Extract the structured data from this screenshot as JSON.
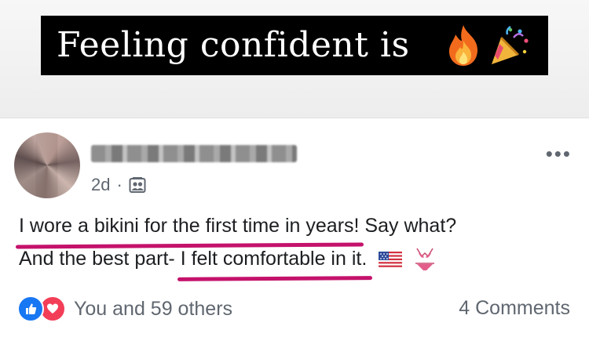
{
  "caption": {
    "text": "Feeling confident is",
    "emojis": [
      "fire-emoji",
      "party-popper-emoji"
    ]
  },
  "post": {
    "time": "2d",
    "separator": "·",
    "audience_icon": "friends-icon",
    "more_label": "•••",
    "text": {
      "line1_highlight": "I wore a bikini for the first time in years!",
      "line1_rest": " Say what?",
      "line2_prefix": "And the best part- ",
      "line2_highlight": "I felt comfortable in it.",
      "line2_emojis": [
        "us-flag-emoji",
        "bikini-emoji"
      ]
    },
    "reactions": {
      "icons": [
        "like-icon",
        "love-icon"
      ],
      "summary": "You and 59 others"
    },
    "comments_label": "4 Comments"
  },
  "colors": {
    "highlight_underline": "#c4126b",
    "like_blue": "#1877f2",
    "love_red": "#f33e58",
    "meta_gray": "#606770"
  }
}
